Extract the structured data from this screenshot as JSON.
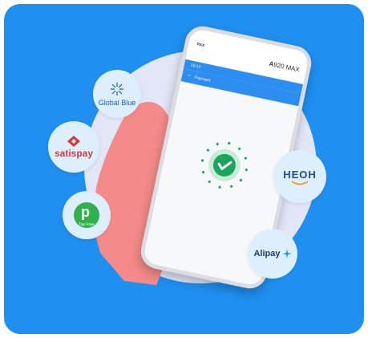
{
  "partners": {
    "global_blue": "Global Blue",
    "satispay": "satispay",
    "tax_free": "Tax Free",
    "heoh": "HEOH",
    "alipay": "Alipay"
  },
  "phone": {
    "brand": "PAX",
    "model_prefix": "A",
    "model_rest": "920 MAX",
    "status_time": "10:12",
    "screen_title": "Payment"
  },
  "colors": {
    "background": "#1f8ff0",
    "accent": "#2c8ef1",
    "success": "#1aa65b"
  }
}
